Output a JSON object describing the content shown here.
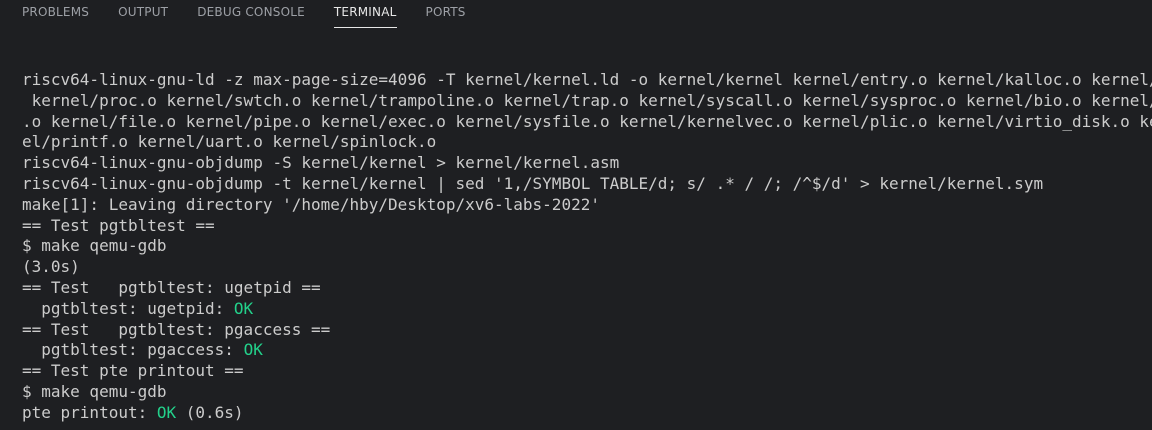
{
  "tabs": [
    {
      "label": "PROBLEMS"
    },
    {
      "label": "OUTPUT"
    },
    {
      "label": "DEBUG CONSOLE"
    },
    {
      "label": "TERMINAL",
      "active": true
    },
    {
      "label": "PORTS"
    }
  ],
  "colors": {
    "background": "#1e1f22",
    "text": "#cccccc",
    "ok": "#23d18b",
    "tab_inactive": "#9da0a6",
    "tab_active": "#e7e7e7"
  },
  "terminal": {
    "lines": [
      {
        "text": "riscv64-linux-gnu-ld -z max-page-size=4096 -T kernel/kernel.ld -o kernel/kernel kernel/entry.o kernel/kalloc.o kernel/string.o"
      },
      {
        "text": " kernel/proc.o kernel/swtch.o kernel/trampoline.o kernel/trap.o kernel/syscall.o kernel/sysproc.o kernel/bio.o kernel/fs.o kernel/log.o kernel/sleeplock"
      },
      {
        "text": ".o kernel/file.o kernel/pipe.o kernel/exec.o kernel/sysfile.o kernel/kernelvec.o kernel/plic.o kernel/virtio_disk.o kernel/start.o kernel/consol"
      },
      {
        "text": "el/printf.o kernel/uart.o kernel/spinlock.o"
      },
      {
        "text": "riscv64-linux-gnu-objdump -S kernel/kernel > kernel/kernel.asm"
      },
      {
        "text": "riscv64-linux-gnu-objdump -t kernel/kernel | sed '1,/SYMBOL TABLE/d; s/ .* / /; /^$/d' > kernel/kernel.sym"
      },
      {
        "text": "make[1]: Leaving directory '/home/hby/Desktop/xv6-labs-2022'"
      },
      {
        "text": "== Test pgtbltest =="
      },
      {
        "text": "$ make qemu-gdb"
      },
      {
        "text": "(3.0s)"
      },
      {
        "text": "== Test   pgtbltest: ugetpid =="
      },
      {
        "text": "  pgtbltest: ugetpid: ",
        "status": "OK"
      },
      {
        "text": "== Test   pgtbltest: pgaccess =="
      },
      {
        "text": "  pgtbltest: pgaccess: ",
        "status": "OK"
      },
      {
        "text": "== Test pte printout =="
      },
      {
        "text": "$ make qemu-gdb"
      },
      {
        "text": "pte printout: ",
        "status": "OK",
        "suffix": " (0.6s)"
      }
    ]
  }
}
